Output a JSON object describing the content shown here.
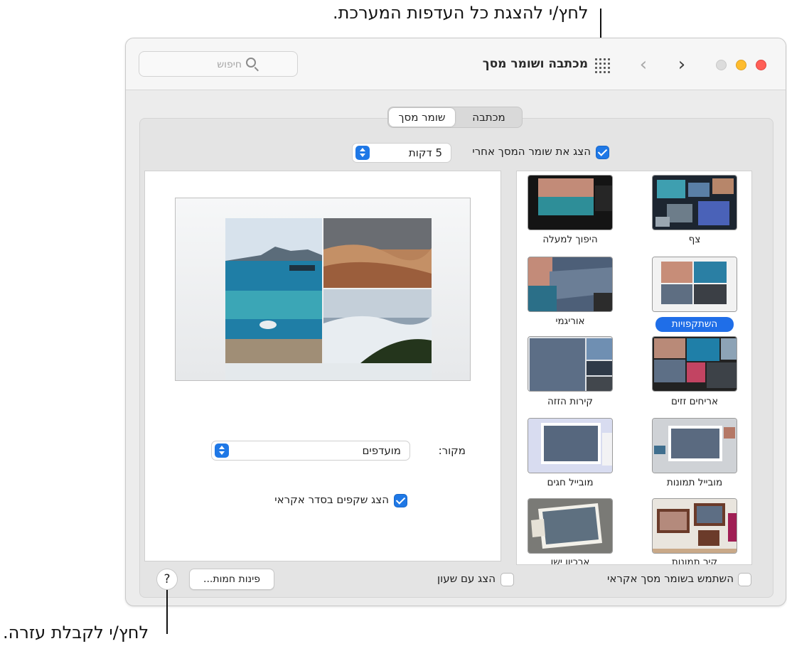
{
  "callouts": {
    "top": "לחץ/י להצגת כל העדפות המערכת.",
    "bottom": "לחץ/י לקבלת עזרה."
  },
  "window": {
    "title": "מכתבה ושומר מסך",
    "search_placeholder": "חיפוש"
  },
  "tabs": [
    {
      "label": "מכתבה",
      "active": false
    },
    {
      "label": "שומר מסך",
      "active": true
    }
  ],
  "show_after": {
    "label": "הצג את שומר המסך אחרי",
    "checked": true,
    "value": "5 דקות"
  },
  "savers": [
    {
      "label": "צף",
      "selected": false
    },
    {
      "label": "היפוך למעלה",
      "selected": false
    },
    {
      "label": "השתקפויות",
      "selected": true
    },
    {
      "label": "אוריגמי",
      "selected": false
    },
    {
      "label": "אריחים זזים",
      "selected": false
    },
    {
      "label": "קירות הזזה",
      "selected": false
    },
    {
      "label": "מובייל תמונות",
      "selected": false
    },
    {
      "label": "מובייל חגים",
      "selected": false
    },
    {
      "label": "קיר תמונות",
      "selected": false
    },
    {
      "label": "ארכיון ישן",
      "selected": false
    }
  ],
  "source": {
    "label": "מקור:",
    "value": "מועדפים"
  },
  "shuffle": {
    "label": "הצג שקפים בסדר אקראי",
    "checked": true
  },
  "bottom": {
    "random_label": "השתמש בשומר מסך אקראי",
    "random_checked": false,
    "clock_label": "הצג עם שעון",
    "clock_checked": false,
    "hot_corners": "פינות חמות...",
    "help": "?"
  },
  "colors": {
    "accent": "#1f78e6",
    "selection": "#1f6ee8"
  }
}
